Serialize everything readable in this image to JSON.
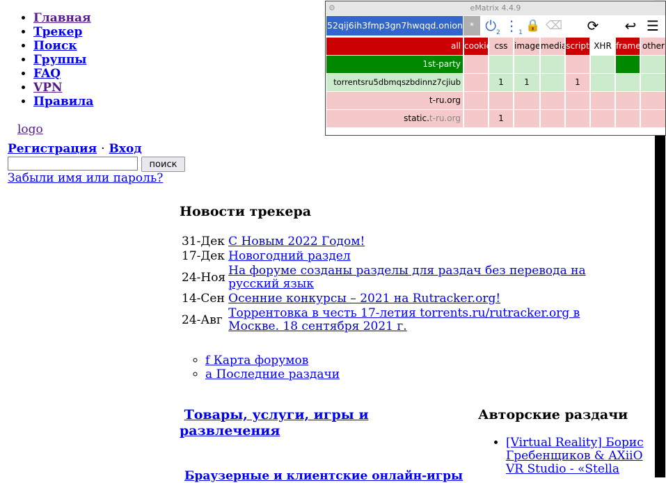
{
  "nav": {
    "items": [
      {
        "label": "Главная",
        "visited": true
      },
      {
        "label": "Трекер",
        "visited": false
      },
      {
        "label": "Поиск",
        "visited": false
      },
      {
        "label": "Группы",
        "visited": false
      },
      {
        "label": "FAQ",
        "visited": false
      },
      {
        "label": "VPN",
        "visited": true
      },
      {
        "label": "Правила",
        "visited": false
      }
    ],
    "logo": "logo"
  },
  "auth": {
    "register": "Регистрация",
    "separator": "·",
    "login": "Вход",
    "search_value": "",
    "submit": "поиск",
    "forgot": "Забыли имя или пароль?"
  },
  "news": {
    "title": "Новости трекера",
    "items": [
      {
        "date": "31-Дек",
        "text": "С Новым 2022 Годом!"
      },
      {
        "date": "17-Дек",
        "text": "Новогодний раздел"
      },
      {
        "date": "24-Ноя",
        "text": "На форуме созданы разделы для раздач без перевода на русский язык"
      },
      {
        "date": "14-Сен",
        "text": "Осенние конкурсы – 2021 на Rutracker.org!"
      },
      {
        "date": "24-Авг",
        "text": "Торрентовка в честь 17-летия torrents.ru/rutracker.org в Москве. 18 сентября 2021 г."
      }
    ]
  },
  "quick_links": [
    {
      "icon": "f",
      "label": "Карта форумов"
    },
    {
      "icon": "a",
      "label": "Последние раздачи"
    }
  ],
  "sections": {
    "main_title": "Товары, услуги, игры и развлечения",
    "sub_title": "Браузерные и клиентские онлайн-игры",
    "author_title": "Авторские раздачи",
    "author_items": [
      "[Virtual Reality] Борис Гребенщиков & AXiiO VR Studio - «Stella"
    ]
  },
  "ematrix": {
    "title": "eMatrix 4.4.9",
    "scope": "52qij6ih3fmp3gn7hwqqd.onion",
    "star": "*",
    "power_count": "2",
    "info_count": "1",
    "columns": [
      "cookie",
      "css",
      "image",
      "media",
      "script",
      "XHR",
      "frame",
      "other"
    ],
    "header_label": "all",
    "rows": [
      {
        "name": "1st-party",
        "name_suffix": "",
        "cells": [
          "",
          "",
          "",
          "",
          "",
          "",
          "",
          ""
        ]
      },
      {
        "name": "torrentsru5dbmqszbdinnz7cjiub",
        "name_suffix": "",
        "cells": [
          "",
          "1",
          "1",
          "",
          "1",
          "",
          "",
          ""
        ]
      },
      {
        "name": "t-ru.org",
        "name_suffix": "",
        "cells": [
          "",
          "",
          "",
          "",
          "",
          "",
          "",
          ""
        ]
      },
      {
        "name": "static.",
        "name_suffix": "t-ru.org",
        "cells": [
          "",
          "1",
          "",
          "",
          "",
          "",
          "",
          ""
        ]
      }
    ]
  }
}
